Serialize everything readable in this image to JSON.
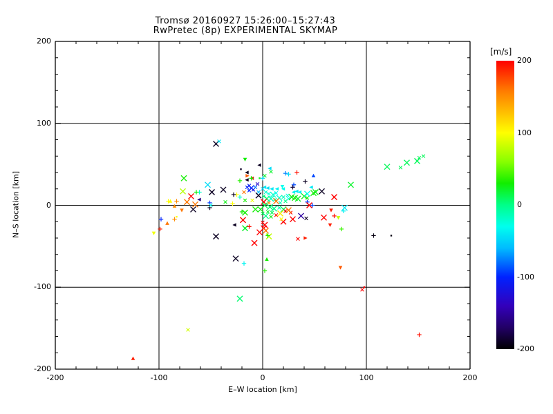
{
  "title": {
    "line1": "Tromsø 20160927 15:26:00–15:27:43",
    "line2": "RwPretec (8p) EXPERIMENTAL SKYMAP"
  },
  "chart_data": {
    "type": "scatter",
    "xlabel": "E–W location [km]",
    "ylabel": "N–S location [km]",
    "xlim": [
      -200,
      200
    ],
    "ylim": [
      -200,
      200
    ],
    "xticks": [
      -200,
      -100,
      0,
      100,
      200
    ],
    "yticks": [
      -200,
      -100,
      0,
      100,
      200
    ],
    "minor_step": 20,
    "grid": true,
    "background": "#ffffff",
    "axis_color": "#000000",
    "colorbar": {
      "label": "[m/s]",
      "min": -200,
      "max": 200,
      "ticks": [
        200,
        100,
        0,
        -100,
        -200
      ],
      "stops": [
        [
          200,
          "#ff0000"
        ],
        [
          160,
          "#ff7700"
        ],
        [
          100,
          "#ffff00"
        ],
        [
          60,
          "#88ff00"
        ],
        [
          30,
          "#11ee00"
        ],
        [
          0,
          "#00ff88"
        ],
        [
          -30,
          "#00ffee"
        ],
        [
          -60,
          "#00bbff"
        ],
        [
          -100,
          "#0022ff"
        ],
        [
          -140,
          "#3300bb"
        ],
        [
          -170,
          "#220066"
        ],
        [
          -200,
          "#000000"
        ]
      ]
    },
    "marker_codes": {
      "X": "large-cross",
      "x": "small-cross",
      "+": "plus",
      ".": "dot",
      "<": "tri-left",
      ">": "tri-right",
      "^": "tri-up",
      "v": "tri-down"
    },
    "points": [
      [
        -125,
        -187,
        190,
        "^"
      ],
      [
        151,
        -158,
        195,
        "+"
      ],
      [
        -72,
        -152,
        85,
        "x"
      ],
      [
        -22,
        -114,
        5,
        "X"
      ],
      [
        96,
        -103,
        200,
        "x"
      ],
      [
        98,
        -100,
        200,
        "."
      ],
      [
        75,
        -76,
        170,
        "v"
      ],
      [
        107,
        -37,
        -195,
        "+"
      ],
      [
        124,
        -37,
        -195,
        "."
      ],
      [
        76,
        -29,
        40,
        "+"
      ],
      [
        -105,
        -34,
        95,
        "v"
      ],
      [
        -99,
        -29,
        190,
        "+"
      ],
      [
        -98,
        -17,
        -100,
        "+"
      ],
      [
        -92,
        -22,
        160,
        "^"
      ],
      [
        -85,
        -17,
        150,
        "+"
      ],
      [
        -83,
        -14,
        100,
        "."
      ],
      [
        -85,
        -1,
        150,
        "^"
      ],
      [
        -78,
        -6,
        160,
        "v"
      ],
      [
        -89,
        5,
        100,
        "^"
      ],
      [
        -91,
        5,
        100,
        "+"
      ],
      [
        -83,
        5,
        150,
        "+"
      ],
      [
        -77,
        17,
        75,
        "X"
      ],
      [
        -76,
        33,
        30,
        "X"
      ],
      [
        -69,
        11,
        200,
        "X"
      ],
      [
        -73,
        4,
        160,
        "X"
      ],
      [
        -65,
        1,
        160,
        "X"
      ],
      [
        -67,
        -5,
        -190,
        "X"
      ],
      [
        -61,
        16,
        -20,
        "+"
      ],
      [
        -64,
        16,
        30,
        "+"
      ],
      [
        -61,
        7,
        -160,
        "<"
      ],
      [
        -53,
        25,
        -45,
        "X"
      ],
      [
        -51,
        3,
        -95,
        "+"
      ],
      [
        -51,
        -3,
        -190,
        "+"
      ],
      [
        -50,
        0,
        -30,
        "x"
      ],
      [
        -49,
        16,
        -190,
        "X"
      ],
      [
        -38,
        19,
        -190,
        "X"
      ],
      [
        -45,
        75,
        -190,
        "X"
      ],
      [
        -42,
        78,
        -40,
        "x"
      ],
      [
        -17,
        56,
        30,
        "v"
      ],
      [
        -21,
        44,
        -190,
        "."
      ],
      [
        -3,
        49,
        -190,
        "<"
      ],
      [
        -15,
        40,
        -190,
        "<"
      ],
      [
        7,
        45,
        -45,
        "<"
      ],
      [
        -3,
        33,
        25,
        "."
      ],
      [
        -22,
        30,
        35,
        "+"
      ],
      [
        -15,
        31,
        -190,
        "<"
      ],
      [
        -15,
        36,
        170,
        ">"
      ],
      [
        -10,
        33,
        200,
        "<"
      ],
      [
        8,
        41,
        20,
        "x"
      ],
      [
        33,
        40,
        195,
        "+"
      ],
      [
        22,
        39,
        -75,
        "+"
      ],
      [
        25,
        38,
        -45,
        "+"
      ],
      [
        2,
        36,
        20,
        "x"
      ],
      [
        0,
        33,
        -50,
        "+"
      ],
      [
        -15,
        22,
        -100,
        "x"
      ],
      [
        -13,
        24,
        -110,
        "x"
      ],
      [
        -11,
        21,
        -100,
        "X"
      ],
      [
        -9,
        19,
        -120,
        "x"
      ],
      [
        -7,
        22,
        -80,
        "x"
      ],
      [
        -13,
        18,
        -100,
        "x"
      ],
      [
        -4,
        16,
        -60,
        "x"
      ],
      [
        -5,
        26,
        -130,
        "x"
      ],
      [
        -25,
        13,
        100,
        "+"
      ],
      [
        -28,
        13,
        -190,
        "+"
      ],
      [
        -18,
        16,
        160,
        "x"
      ],
      [
        -4,
        12,
        -190,
        "X"
      ],
      [
        -29,
        2,
        100,
        "+"
      ],
      [
        -36,
        4,
        25,
        "x"
      ],
      [
        -22,
        10,
        -20,
        "+"
      ],
      [
        -17,
        6,
        30,
        "x"
      ],
      [
        -10,
        6,
        95,
        "x"
      ],
      [
        -11,
        33,
        30,
        "+"
      ],
      [
        -20,
        -8,
        30,
        "+"
      ],
      [
        -17,
        -9,
        30,
        "X"
      ],
      [
        0,
        20,
        -50,
        "x"
      ],
      [
        2,
        22,
        -40,
        "<"
      ],
      [
        5,
        21,
        -45,
        "<"
      ],
      [
        9,
        20,
        -40,
        "<"
      ],
      [
        14,
        20,
        -35,
        "<"
      ],
      [
        20,
        20,
        -30,
        "<"
      ],
      [
        19,
        23,
        -30,
        "v"
      ],
      [
        3,
        16,
        -20,
        "x"
      ],
      [
        6,
        14,
        -25,
        "x"
      ],
      [
        10,
        13,
        -20,
        "X"
      ],
      [
        13,
        15,
        -30,
        "x"
      ],
      [
        1,
        11,
        0,
        "x"
      ],
      [
        4,
        8,
        5,
        "X"
      ],
      [
        8,
        8,
        -15,
        "X"
      ],
      [
        12,
        7,
        -10,
        "x"
      ],
      [
        16,
        9,
        -20,
        "X"
      ],
      [
        20,
        10,
        -15,
        "x"
      ],
      [
        24,
        12,
        -25,
        "x"
      ],
      [
        1,
        4,
        200,
        "X"
      ],
      [
        6,
        3,
        150,
        "x"
      ],
      [
        13,
        5,
        160,
        "X"
      ],
      [
        17,
        3,
        -15,
        "x"
      ],
      [
        22,
        5,
        0,
        "x"
      ],
      [
        2,
        0,
        10,
        "X"
      ],
      [
        7,
        -2,
        5,
        "X"
      ],
      [
        11,
        -4,
        0,
        "X"
      ],
      [
        16,
        -3,
        -10,
        "x"
      ],
      [
        20,
        -5,
        10,
        "X"
      ],
      [
        -2,
        -5,
        25,
        "X"
      ],
      [
        -7,
        -5,
        30,
        "X"
      ],
      [
        0,
        -10,
        15,
        "x"
      ],
      [
        5,
        -8,
        20,
        "x"
      ],
      [
        9,
        -9,
        10,
        "x"
      ],
      [
        3,
        -13,
        0,
        "X"
      ],
      [
        8,
        -14,
        25,
        "x"
      ],
      [
        13,
        -12,
        195,
        "x"
      ],
      [
        22,
        -7,
        200,
        "x"
      ],
      [
        25,
        8,
        -30,
        "x"
      ],
      [
        28,
        10,
        25,
        "X"
      ],
      [
        31,
        9,
        30,
        "X"
      ],
      [
        34,
        8,
        20,
        "X"
      ],
      [
        30,
        16,
        -35,
        "<"
      ],
      [
        33,
        17,
        -40,
        "<"
      ],
      [
        36,
        16,
        -35,
        "<"
      ],
      [
        30,
        25,
        -90,
        "+"
      ],
      [
        29,
        22,
        -185,
        "+"
      ],
      [
        40,
        11,
        25,
        "X"
      ],
      [
        43,
        9,
        30,
        "x"
      ],
      [
        43,
        14,
        -30,
        "X"
      ],
      [
        41,
        29,
        -190,
        "+"
      ],
      [
        43,
        4,
        -95,
        "+"
      ],
      [
        48,
        0,
        -90,
        "+"
      ],
      [
        45,
        0,
        200,
        "X"
      ],
      [
        49,
        15,
        30,
        "X"
      ],
      [
        57,
        17,
        -190,
        "X"
      ],
      [
        51,
        16,
        25,
        "X"
      ],
      [
        47,
        22,
        -40,
        "<"
      ],
      [
        49,
        36,
        -90,
        "^"
      ],
      [
        69,
        10,
        200,
        "X"
      ],
      [
        85,
        25,
        20,
        "X"
      ],
      [
        120,
        47,
        10,
        "X"
      ],
      [
        133,
        46,
        10,
        "x"
      ],
      [
        139,
        52,
        10,
        "X"
      ],
      [
        149,
        54,
        10,
        "X"
      ],
      [
        151,
        58,
        10,
        "x"
      ],
      [
        155,
        60,
        10,
        "x"
      ],
      [
        79,
        -3,
        -40,
        "X"
      ],
      [
        66,
        -6,
        190,
        "v"
      ],
      [
        69,
        -13,
        195,
        "+"
      ],
      [
        73,
        -15,
        80,
        "v"
      ],
      [
        78,
        -7,
        -35,
        "+"
      ],
      [
        59,
        -15,
        200,
        "X"
      ],
      [
        37,
        -13,
        -150,
        "X"
      ],
      [
        42,
        -16,
        -190,
        "x"
      ],
      [
        65,
        -24,
        190,
        "v"
      ],
      [
        27,
        -9,
        200,
        "x"
      ],
      [
        20,
        -20,
        200,
        "X"
      ],
      [
        29,
        -17,
        200,
        "X"
      ],
      [
        18,
        -17,
        100,
        "x"
      ],
      [
        17,
        -10,
        110,
        "X"
      ],
      [
        25,
        -6,
        160,
        "X"
      ],
      [
        0,
        -21,
        200,
        "x"
      ],
      [
        2,
        -24,
        200,
        "X"
      ],
      [
        1,
        -28,
        200,
        "X"
      ],
      [
        3,
        -31,
        160,
        "X"
      ],
      [
        -3,
        -33,
        200,
        "X"
      ],
      [
        6,
        -38,
        80,
        "X"
      ],
      [
        -8,
        -46,
        200,
        "X"
      ],
      [
        34,
        -41,
        200,
        "x"
      ],
      [
        41,
        -40,
        190,
        ">"
      ],
      [
        -19,
        -18,
        200,
        "X"
      ],
      [
        -17,
        -28,
        20,
        "X"
      ],
      [
        -13,
        -26,
        195,
        "+"
      ],
      [
        -27,
        -24,
        -190,
        "<"
      ],
      [
        -45,
        -38,
        -190,
        "X"
      ],
      [
        -26,
        -65,
        -190,
        "X"
      ],
      [
        -18,
        -71,
        -35,
        "+"
      ],
      [
        4,
        -66,
        30,
        "^"
      ],
      [
        2,
        -80,
        35,
        "+"
      ],
      [
        5,
        -37,
        30,
        "+"
      ]
    ]
  }
}
